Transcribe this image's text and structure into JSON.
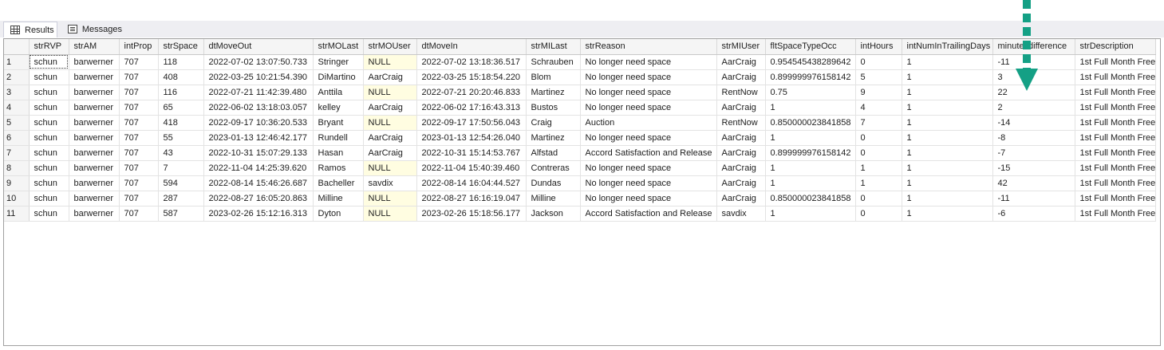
{
  "tabs": [
    {
      "label": "Results",
      "icon": "grid-icon"
    },
    {
      "label": "Messages",
      "icon": "messages-icon"
    }
  ],
  "columns": [
    "strRVP",
    "strAM",
    "intProp",
    "strSpace",
    "dtMoveOut",
    "strMOLast",
    "strMOUser",
    "dtMoveIn",
    "strMILast",
    "strReason",
    "strMIUser",
    "fltSpaceTypeOcc",
    "intHours",
    "intNumInTrailingDays",
    "minutesdifference",
    "strDescription"
  ],
  "rows": [
    [
      "1",
      "schun",
      "barwerner",
      "707",
      "118",
      "2022-07-02 13:07:50.733",
      "Stringer",
      "NULL",
      "2022-07-02 13:18:36.517",
      "Schrauben",
      "No longer need space",
      "AarCraig",
      "0.954545438289642",
      "0",
      "1",
      "-11",
      "1st Full Month Free"
    ],
    [
      "2",
      "schun",
      "barwerner",
      "707",
      "408",
      "2022-03-25 10:21:54.390",
      "DiMartino",
      "AarCraig",
      "2022-03-25 15:18:54.220",
      "Blom",
      "No longer need space",
      "AarCraig",
      "0.899999976158142",
      "5",
      "1",
      "3",
      "1st Full Month Free"
    ],
    [
      "3",
      "schun",
      "barwerner",
      "707",
      "116",
      "2022-07-21 11:42:39.480",
      "Anttila",
      "NULL",
      "2022-07-21 20:20:46.833",
      "Martinez",
      "No longer need space",
      "RentNow",
      "0.75",
      "9",
      "1",
      "22",
      "1st Full Month Free"
    ],
    [
      "4",
      "schun",
      "barwerner",
      "707",
      "65",
      "2022-06-02 13:18:03.057",
      "kelley",
      "AarCraig",
      "2022-06-02 17:16:43.313",
      "Bustos",
      "No longer need space",
      "AarCraig",
      "1",
      "4",
      "1",
      "2",
      "1st Full Month Free"
    ],
    [
      "5",
      "schun",
      "barwerner",
      "707",
      "418",
      "2022-09-17 10:36:20.533",
      "Bryant",
      "NULL",
      "2022-09-17 17:50:56.043",
      "Craig",
      "Auction",
      "RentNow",
      "0.850000023841858",
      "7",
      "1",
      "-14",
      "1st Full Month Free"
    ],
    [
      "6",
      "schun",
      "barwerner",
      "707",
      "55",
      "2023-01-13 12:46:42.177",
      "Rundell",
      "AarCraig",
      "2023-01-13 12:54:26.040",
      "Martinez",
      "No longer need space",
      "AarCraig",
      "1",
      "0",
      "1",
      "-8",
      "1st Full Month Free"
    ],
    [
      "7",
      "schun",
      "barwerner",
      "707",
      "43",
      "2022-10-31 15:07:29.133",
      "Hasan",
      "AarCraig",
      "2022-10-31 15:14:53.767",
      "Alfstad",
      "Accord Satisfaction and Release",
      "AarCraig",
      "0.899999976158142",
      "0",
      "1",
      "-7",
      "1st Full Month Free"
    ],
    [
      "8",
      "schun",
      "barwerner",
      "707",
      "7",
      "2022-11-04 14:25:39.620",
      "Ramos",
      "NULL",
      "2022-11-04 15:40:39.460",
      "Contreras",
      "No longer need space",
      "AarCraig",
      "1",
      "1",
      "1",
      "-15",
      "1st Full Month Free"
    ],
    [
      "9",
      "schun",
      "barwerner",
      "707",
      "594",
      "2022-08-14 15:46:26.687",
      "Bacheller",
      "savdix",
      "2022-08-14 16:04:44.527",
      "Dundas",
      "No longer need space",
      "AarCraig",
      "1",
      "1",
      "1",
      "42",
      "1st Full Month Free"
    ],
    [
      "10",
      "schun",
      "barwerner",
      "707",
      "287",
      "2022-08-27 16:05:20.863",
      "Milline",
      "NULL",
      "2022-08-27 16:16:19.047",
      "Milline",
      "No longer need space",
      "AarCraig",
      "0.850000023841858",
      "0",
      "1",
      "-11",
      "1st Full Month Free"
    ],
    [
      "11",
      "schun",
      "barwerner",
      "707",
      "587",
      "2023-02-26 15:12:16.313",
      "Dyton",
      "NULL",
      "2023-02-26 15:18:56.177",
      "Jackson",
      "Accord Satisfaction and Release",
      "savdix",
      "1",
      "0",
      "1",
      "-6",
      "1st Full Month Free"
    ]
  ],
  "annotation": {
    "type": "dashed-arrow-down",
    "color": "#14a085"
  }
}
